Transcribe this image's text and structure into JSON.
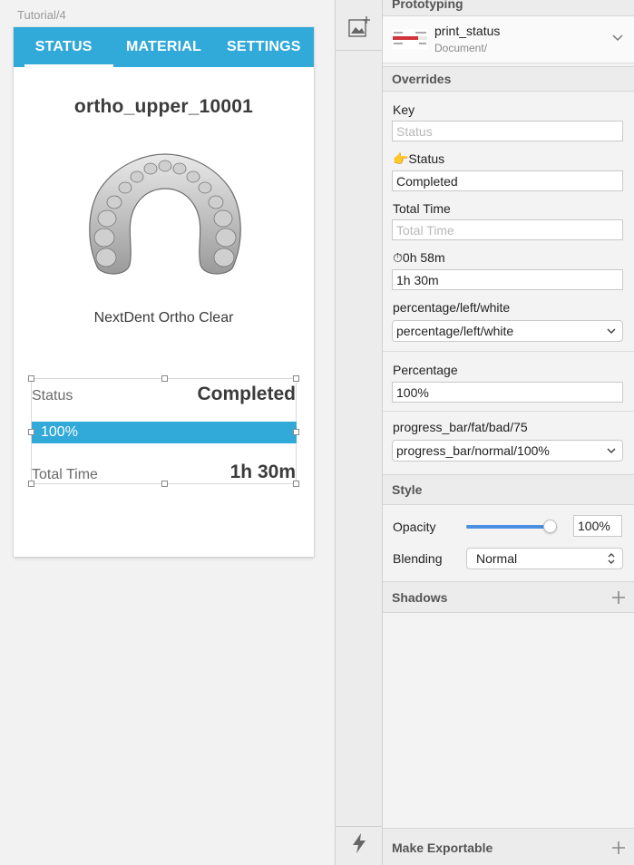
{
  "canvas": {
    "artboard_label": "Tutorial/4",
    "tabs": [
      {
        "label": "STATUS",
        "active": true
      },
      {
        "label": "MATERIAL",
        "active": false
      },
      {
        "label": "SETTINGS",
        "active": false
      }
    ],
    "model_title": "ortho_upper_10001",
    "material_name": "NextDent Ortho Clear",
    "status_label": "Status",
    "status_value": "Completed",
    "progress_text": "100%",
    "progress_fraction": 1.0,
    "total_time_label": "Total Time",
    "total_time_value": "1h 30m"
  },
  "toolbar": {
    "top_icon": "insert-image-icon",
    "bottom_icon": "lightning-icon"
  },
  "inspector": {
    "prototyping_title": "Prototyping",
    "symbol_name": "print_status",
    "symbol_path": "Document/",
    "overrides_title": "Overrides",
    "key_label": "Key",
    "key_placeholder": "Status",
    "status_label": "👉Status",
    "status_value": "Completed",
    "total_time_label": "Total Time",
    "total_time_placeholder": "Total Time",
    "time_override_label": "⏱0h 58m",
    "time_override_value": "1h 30m",
    "percentage_style_label": "percentage/left/white",
    "percentage_style_value": "percentage/left/white",
    "percentage_label": "Percentage",
    "percentage_value": "100%",
    "progress_bar_label": "progress_bar/fat/bad/75",
    "progress_bar_value": "progress_bar/normal/100%",
    "style_title": "Style",
    "opacity_label": "Opacity",
    "opacity_value": "100%",
    "opacity_fraction": 1.0,
    "blending_label": "Blending",
    "blending_value": "Normal",
    "shadows_title": "Shadows",
    "make_exportable_title": "Make Exportable"
  },
  "colors": {
    "accent": "#31a9d9",
    "slider": "#4a90e2"
  }
}
